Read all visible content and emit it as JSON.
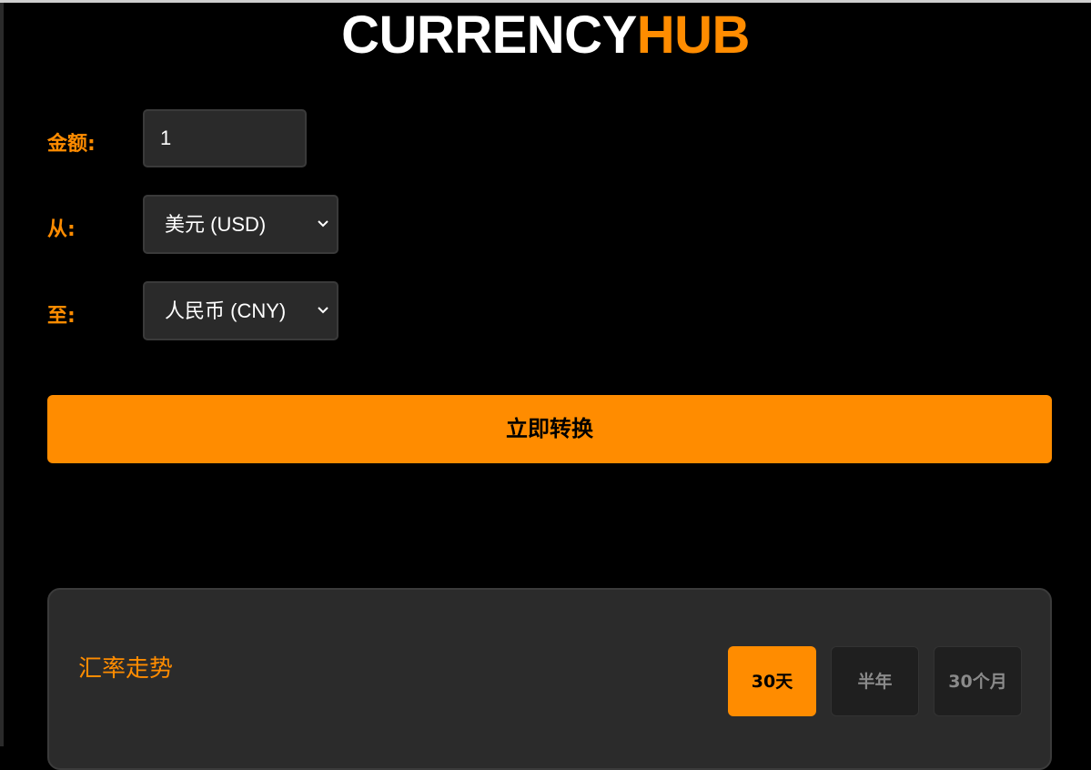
{
  "header": {
    "logo_part1": "CURRENCY",
    "logo_part2": "HUB"
  },
  "form": {
    "amount_label": "金额:",
    "amount_value": "1",
    "from_label": "从:",
    "from_value": "美元 (USD)",
    "to_label": "至:",
    "to_value": "人民币 (CNY)",
    "convert_button": "立即转换"
  },
  "trend": {
    "title": "汇率走势",
    "ranges": [
      {
        "label": "30天",
        "active": true
      },
      {
        "label": "半年",
        "active": false
      },
      {
        "label": "30个月",
        "active": false
      }
    ]
  },
  "colors": {
    "accent": "#ff8c00",
    "background": "#000000",
    "panel": "#2b2b2b"
  }
}
